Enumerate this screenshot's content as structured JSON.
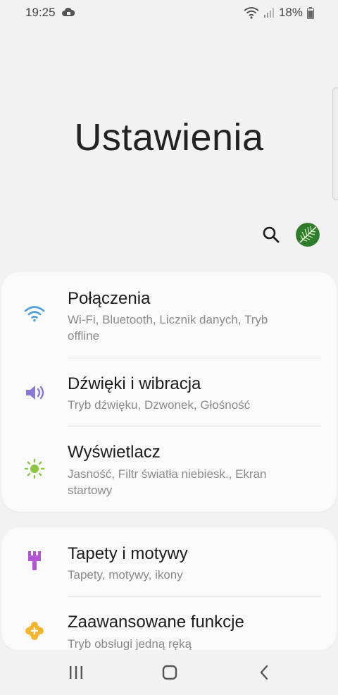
{
  "status_bar": {
    "time": "19:25",
    "battery_text": "18%",
    "icons": [
      "cloud-sync-icon",
      "wifi-icon",
      "signal-icon",
      "battery-icon"
    ]
  },
  "page": {
    "title": "Ustawienia"
  },
  "header_actions": {
    "search_icon": "search-icon",
    "avatar_icon": "avatar"
  },
  "cards": [
    {
      "items": [
        {
          "title": "Połączenia",
          "subtitle": "Wi-Fi, Bluetooth, Licznik danych, Tryb offline",
          "icon": "wifi-icon",
          "color": "#4a9fe0"
        },
        {
          "title": "Dźwięki i wibracja",
          "subtitle": "Tryb dźwięku, Dzwonek, Głośność",
          "icon": "speaker-icon",
          "color": "#8b78d8"
        },
        {
          "title": "Wyświetlacz",
          "subtitle": "Jasność, Filtr światła niebiesk., Ekran startowy",
          "icon": "brightness-icon",
          "color": "#8cc63f"
        }
      ]
    },
    {
      "items": [
        {
          "title": "Tapety i motywy",
          "subtitle": "Tapety, motywy, ikony",
          "icon": "paintbrush-icon",
          "color": "#b454d6"
        },
        {
          "title": "Zaawansowane funkcje",
          "subtitle": "Tryb obsługi jedną ręką",
          "icon": "puzzle-plus-icon",
          "color": "#f3b62c"
        }
      ]
    }
  ],
  "nav_bar": {
    "buttons": [
      "recent-apps-icon",
      "home-icon",
      "back-icon"
    ]
  }
}
